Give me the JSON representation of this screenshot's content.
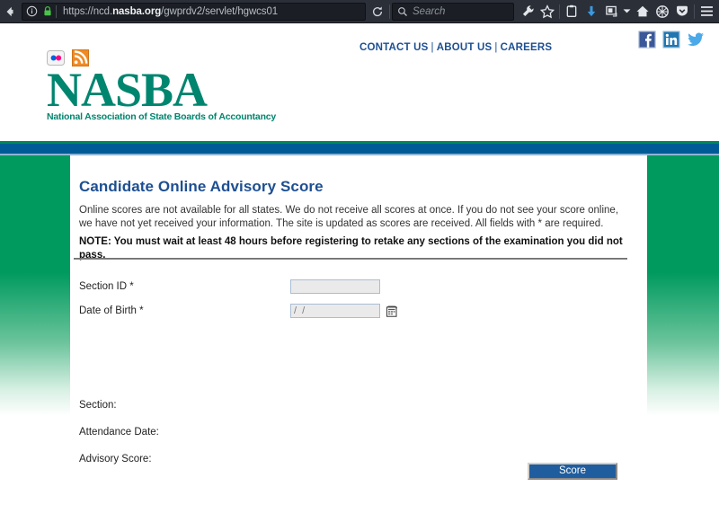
{
  "browser": {
    "back_icon": "back-arrow-icon",
    "info_icon": "info-circle-icon",
    "lock_icon": "padlock-icon",
    "url_prefix": "https://ncd.",
    "url_domain": "nasba.org",
    "url_path": "/gwprdv2/servlet/hgwcs01",
    "url_full": "https://ncd.nasba.org/gwprdv2/servlet/hgwcs01",
    "reload_icon": "reload-icon",
    "search_placeholder": "Search",
    "search_icon": "magnifier-icon",
    "toolbar_icons": [
      "wrench-icon",
      "star-icon",
      "reader-list-icon",
      "download-arrow-icon",
      "sync-device-icon",
      "chevron-down-icon",
      "home-icon",
      "globe-shield-icon",
      "pocket-icon",
      "hamburger-menu-icon"
    ]
  },
  "header": {
    "badges": [
      {
        "name": "flickr-icon",
        "label": "Flickr"
      },
      {
        "name": "rss-icon",
        "label": "RSS"
      }
    ],
    "logo_word": "NASBA",
    "logo_tagline": "National Association of State Boards of Accountancy",
    "nav": [
      {
        "label": "CONTACT US"
      },
      {
        "label": "ABOUT US"
      },
      {
        "label": "CAREERS"
      }
    ],
    "nav_separator": "|",
    "social": [
      {
        "name": "facebook-icon",
        "label": "Facebook"
      },
      {
        "name": "linkedin-icon",
        "label": "LinkedIn"
      },
      {
        "name": "twitter-icon",
        "label": "Twitter"
      }
    ]
  },
  "main": {
    "title": "Candidate Online Advisory Score",
    "intro": "Online scores are not available for all states. We do not receive all scores at once. If you do not see your score online, we have not yet received your information. The site is updated as scores are received. All fields with * are required.",
    "note": "NOTE: You must wait at least 48 hours before registering to retake any sections of the examination you did not pass.",
    "form": {
      "section_id_label": "Section ID *",
      "section_id_value": "",
      "section_id_placeholder": "",
      "dob_label": "Date of Birth *",
      "dob_value": "/  /",
      "dob_placeholder": "/  /",
      "calendar_icon": "calendar-picker-icon"
    },
    "results": [
      {
        "label": "Section:",
        "value": ""
      },
      {
        "label": "Attendance Date:",
        "value": ""
      },
      {
        "label": "Advisory Score:",
        "value": ""
      }
    ],
    "submit_label": "Score"
  },
  "colors": {
    "brand_green": "#009a5f",
    "logo_teal": "#00856f",
    "band_blue": "#005a96",
    "link_blue": "#1d4f91",
    "button_blue": "#1f5d9e",
    "rss_orange": "#f08a24"
  }
}
